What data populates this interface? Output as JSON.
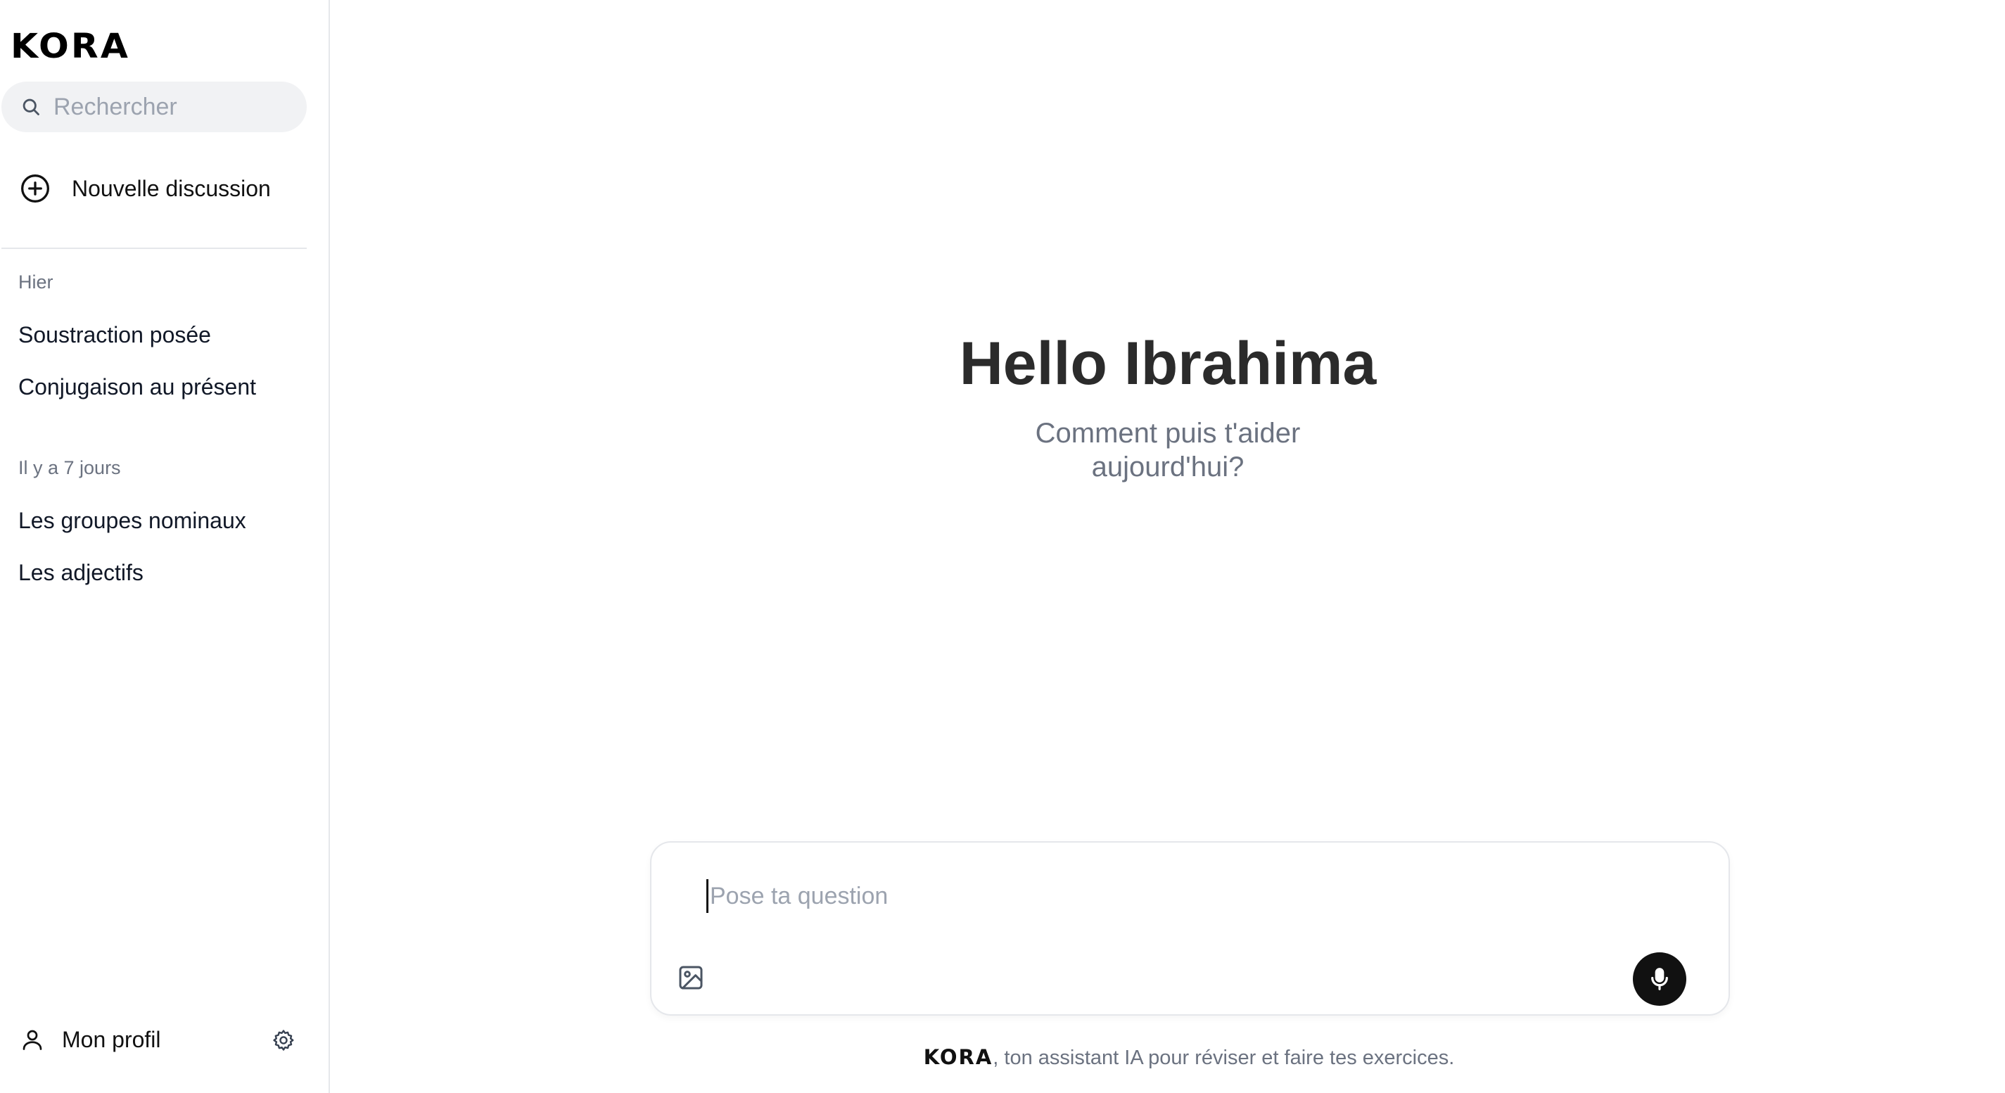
{
  "sidebar": {
    "logo": "KORA",
    "search": {
      "placeholder": "Rechercher"
    },
    "new_chat_label": "Nouvelle discussion",
    "groups": [
      {
        "label": "Hier",
        "items": [
          "Soustraction posée",
          "Conjugaison au présent"
        ]
      },
      {
        "label": "Il y a 7 jours",
        "items": [
          "Les groupes nominaux",
          "Les adjectifs"
        ]
      }
    ],
    "profile_label": "Mon profil"
  },
  "main": {
    "greeting": "Hello Ibrahima",
    "subtitle_line1": "Comment puis t'aider",
    "subtitle_line2": "aujourd'hui?",
    "composer": {
      "placeholder": "Pose ta question",
      "value": ""
    },
    "footer": {
      "brand": "KORA",
      "text": ", ton assistant IA pour réviser et faire tes exercices."
    }
  },
  "icons": {
    "search": "search-icon",
    "new_chat": "plus-circle-icon",
    "profile": "user-icon",
    "settings": "gear-icon",
    "image": "image-icon",
    "mic": "microphone-icon"
  },
  "colors": {
    "accent": "#111111",
    "muted_text": "#6b7280",
    "search_bg": "#f1f2f4",
    "border": "#e5e7eb"
  }
}
